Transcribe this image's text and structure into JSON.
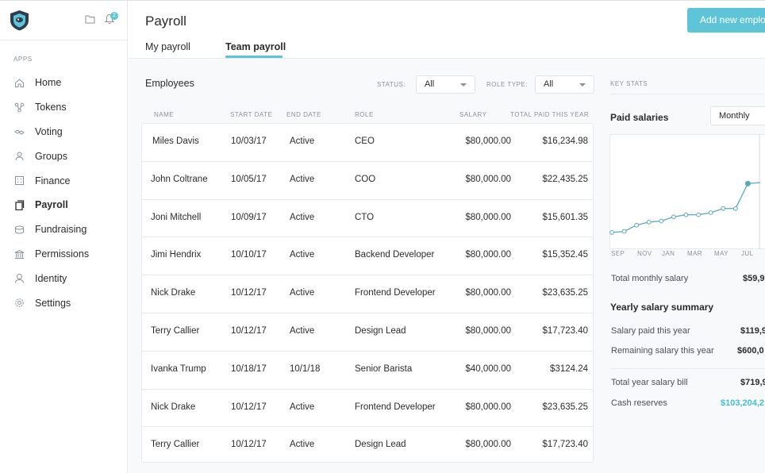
{
  "sidebar": {
    "badge_count": "2",
    "apps_label": "APPS",
    "items": [
      {
        "label": "Home",
        "icon": "home-icon"
      },
      {
        "label": "Tokens",
        "icon": "tokens-icon"
      },
      {
        "label": "Voting",
        "icon": "voting-icon"
      },
      {
        "label": "Groups",
        "icon": "groups-icon"
      },
      {
        "label": "Finance",
        "icon": "finance-icon"
      },
      {
        "label": "Payroll",
        "icon": "payroll-icon",
        "active": true
      },
      {
        "label": "Fundraising",
        "icon": "fundraising-icon"
      },
      {
        "label": "Permissions",
        "icon": "permissions-icon"
      },
      {
        "label": "Identity",
        "icon": "identity-icon"
      },
      {
        "label": "Settings",
        "icon": "settings-icon"
      }
    ]
  },
  "header": {
    "title": "Payroll",
    "add_button": "Add new employee",
    "tabs": [
      {
        "label": "My payroll"
      },
      {
        "label": "Team payroll",
        "active": true
      }
    ]
  },
  "employees": {
    "title": "Employees",
    "status_label": "STATUS:",
    "status_value": "All",
    "role_type_label": "ROLE TYPE:",
    "role_type_value": "All",
    "columns": [
      "NAME",
      "START DATE",
      "END DATE",
      "ROLE",
      "SALARY",
      "TOTAL PAID THIS YEAR"
    ],
    "rows": [
      {
        "name": "Miles Davis",
        "start": "10/03/17",
        "end": "Active",
        "role": "CEO",
        "salary": "$80,000.00",
        "paid": "$16,234.98"
      },
      {
        "name": "John Coltrane",
        "start": "10/05/17",
        "end": "Active",
        "role": "COO",
        "salary": "$80,000.00",
        "paid": "$22,435.25"
      },
      {
        "name": "Joni Mitchell",
        "start": "10/09/17",
        "end": "Active",
        "role": "CTO",
        "salary": "$80,000.00",
        "paid": "$15,601.35"
      },
      {
        "name": "Jimi Hendrix",
        "start": "10/10/17",
        "end": "Active",
        "role": "Backend Developer",
        "salary": "$80,000.00",
        "paid": "$15,352.45"
      },
      {
        "name": "Nick Drake",
        "start": "10/12/17",
        "end": "Active",
        "role": "Frontend Developer",
        "salary": "$80,000.00",
        "paid": "$23,635.25"
      },
      {
        "name": "Terry Callier",
        "start": "10/12/17",
        "end": "Active",
        "role": "Design Lead",
        "salary": "$80,000.00",
        "paid": "$17,723.40"
      },
      {
        "name": "Ivanka Trump",
        "start": "10/18/17",
        "end": "10/1/18",
        "role": "Senior Barista",
        "salary": "$40,000.00",
        "paid": "$3124.24"
      },
      {
        "name": "Nick Drake",
        "start": "10/12/17",
        "end": "Active",
        "role": "Frontend Developer",
        "salary": "$80,000.00",
        "paid": "$23,635.25"
      },
      {
        "name": "Terry Callier",
        "start": "10/12/17",
        "end": "Active",
        "role": "Design Lead",
        "salary": "$80,000.00",
        "paid": "$17,723.40"
      }
    ]
  },
  "key_stats": {
    "label": "KEY STATS",
    "paid_salaries_title": "Paid salaries",
    "period_value": "Monthly",
    "months": [
      "SEP",
      "NOV",
      "JAN",
      "MAR",
      "MAY",
      "JUL"
    ],
    "total_monthly_label": "Total monthly salary",
    "total_monthly_value": "$59,9",
    "yearly_title": "Yearly salary summary",
    "paid_year_label": "Salary paid this year",
    "paid_year_value": "$119,9",
    "remaining_label": "Remaining salary this year",
    "remaining_value": "$600,0",
    "total_bill_label": "Total year salary bill",
    "total_bill_value": "$719,9",
    "cash_label": "Cash reserves",
    "cash_value": "$103,204,2"
  },
  "chart_data": {
    "type": "line",
    "title": "Paid salaries",
    "x": [
      "SEP",
      "",
      "NOV",
      "",
      "JAN",
      "",
      "MAR",
      "",
      "MAY",
      "",
      "JUL",
      ""
    ],
    "series": [
      {
        "values": [
          0.1,
          0.11,
          0.17,
          0.2,
          0.21,
          0.25,
          0.27,
          0.27,
          0.29,
          0.33,
          0.33,
          0.57,
          0.58
        ]
      }
    ],
    "ylim": [
      0,
      1
    ],
    "grid": false
  },
  "colors": {
    "accent": "#5ec5d8",
    "cash_value": "#45bfd2",
    "line": "#5ba8b9"
  }
}
